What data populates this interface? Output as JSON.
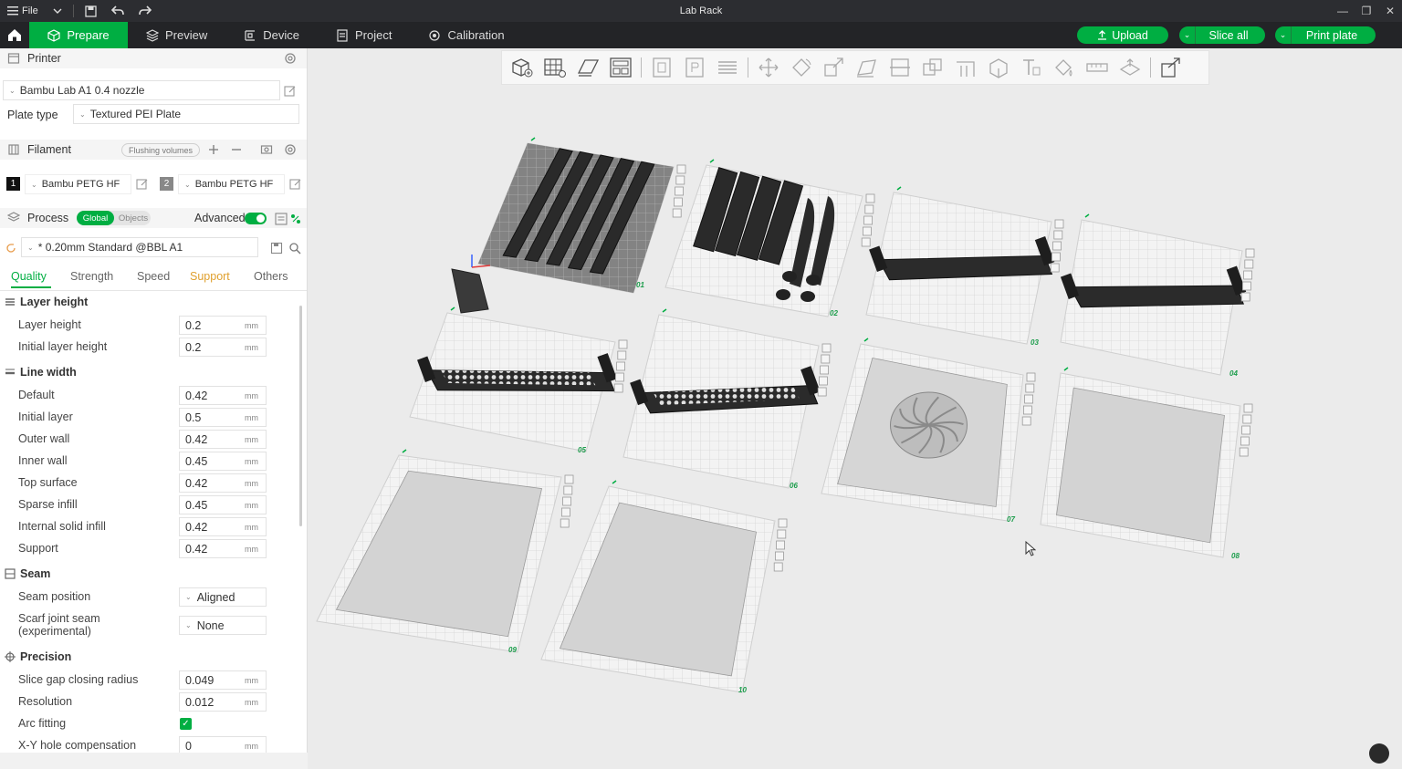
{
  "app": {
    "title": "Lab Rack",
    "file_menu": "File"
  },
  "tabs": [
    {
      "label": "Prepare",
      "icon": "cube-icon",
      "active": true
    },
    {
      "label": "Preview",
      "icon": "layers-icon",
      "active": false
    },
    {
      "label": "Device",
      "icon": "device-icon",
      "active": false
    },
    {
      "label": "Project",
      "icon": "project-icon",
      "active": false
    },
    {
      "label": "Calibration",
      "icon": "calibration-icon",
      "active": false
    }
  ],
  "actions": {
    "upload": "Upload",
    "slice_all": "Slice all",
    "print_plate": "Print plate"
  },
  "printer": {
    "heading": "Printer",
    "name": "Bambu Lab A1 0.4 nozzle",
    "plate_type_label": "Plate type",
    "plate_type": "Textured PEI Plate"
  },
  "filament": {
    "heading": "Filament",
    "flushing_label": "Flushing volumes",
    "slots": [
      {
        "index": "1",
        "name": "Bambu PETG HF",
        "color": "#111111"
      },
      {
        "index": "2",
        "name": "Bambu PETG HF",
        "color": "#888888"
      }
    ]
  },
  "process": {
    "heading": "Process",
    "global_label": "Global",
    "objects_label": "Objects",
    "advanced_label": "Advanced",
    "advanced_on": true,
    "preset": "* 0.20mm Standard @BBL A1"
  },
  "quality_tabs": [
    "Quality",
    "Strength",
    "Speed",
    "Support",
    "Others"
  ],
  "groups": {
    "layer_height": {
      "title": "Layer height",
      "rows": [
        {
          "label": "Layer height",
          "value": "0.2",
          "unit": "mm"
        },
        {
          "label": "Initial layer height",
          "value": "0.2",
          "unit": "mm"
        }
      ]
    },
    "line_width": {
      "title": "Line width",
      "rows": [
        {
          "label": "Default",
          "value": "0.42",
          "unit": "mm"
        },
        {
          "label": "Initial layer",
          "value": "0.5",
          "unit": "mm"
        },
        {
          "label": "Outer wall",
          "value": "0.42",
          "unit": "mm"
        },
        {
          "label": "Inner wall",
          "value": "0.45",
          "unit": "mm"
        },
        {
          "label": "Top surface",
          "value": "0.42",
          "unit": "mm"
        },
        {
          "label": "Sparse infill",
          "value": "0.45",
          "unit": "mm"
        },
        {
          "label": "Internal solid infill",
          "value": "0.42",
          "unit": "mm"
        },
        {
          "label": "Support",
          "value": "0.42",
          "unit": "mm"
        }
      ]
    },
    "seam": {
      "title": "Seam",
      "position_label": "Seam position",
      "position_value": "Aligned",
      "scarf_label_1": "Scarf joint seam",
      "scarf_label_2": "(experimental)",
      "scarf_value": "None"
    },
    "precision": {
      "title": "Precision",
      "rows": [
        {
          "label": "Slice gap closing radius",
          "value": "0.049",
          "unit": "mm"
        },
        {
          "label": "Resolution",
          "value": "0.012",
          "unit": "mm"
        }
      ],
      "arc_fitting_label": "Arc fitting",
      "arc_fitting": true,
      "xy_hole_label": "X-Y hole compensation",
      "xy_hole_value": "0",
      "xy_hole_unit": "mm"
    }
  },
  "plates": [
    "01",
    "02",
    "03",
    "04",
    "05",
    "06",
    "07",
    "08",
    "09",
    "10"
  ],
  "colors": {
    "accent": "#00ae42",
    "titlebar": "#2c2d31",
    "tabbar": "#232427",
    "viewport": "#ebebeb"
  }
}
